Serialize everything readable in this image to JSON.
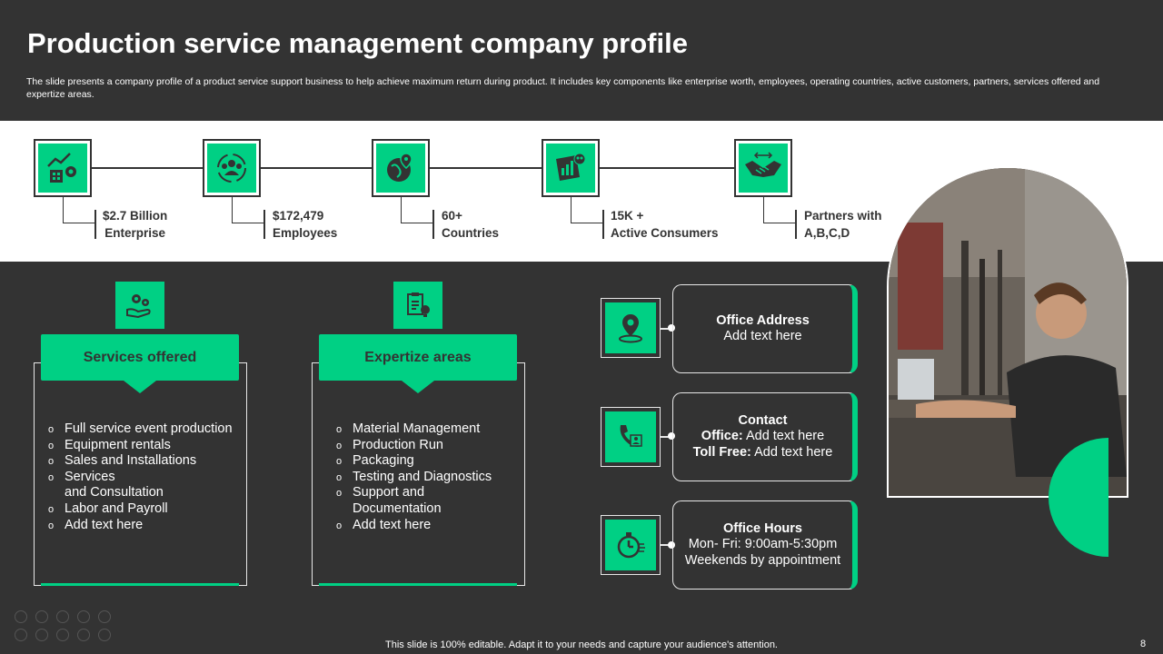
{
  "title": "Production service management company profile",
  "subtitle": "The slide presents a company profile of a product service support business to help achieve maximum return during product. It includes key components like enterprise worth, employees, operating countries, active customers, partners, services offered and expertize areas.",
  "stats": [
    {
      "icon": "growth-chart-icon",
      "line1": "$2.7 Billion",
      "line2": "Enterprise"
    },
    {
      "icon": "team-icon",
      "line1": "$172,479",
      "line2": "Employees"
    },
    {
      "icon": "globe-location-icon",
      "line1": "60+",
      "line2": "Countries"
    },
    {
      "icon": "customers-icon",
      "line1": "15K +",
      "line2": "Active Consumers"
    },
    {
      "icon": "handshake-icon",
      "line1": "Partners with",
      "line2": "A,B,C,D"
    }
  ],
  "services": {
    "icon": "hand-gears-icon",
    "heading": "Services offered",
    "items": [
      "Full service event production",
      "Equipment rentals",
      "Sales and Installations",
      "Services",
      "and Consultation",
      "Labor and Payroll",
      "Add text here"
    ]
  },
  "expertise": {
    "icon": "clipboard-bulb-icon",
    "heading": "Expertize areas",
    "items": [
      "Material Management",
      "Production Run",
      "Packaging",
      "Testing and Diagnostics",
      "Support and",
      "Documentation",
      "Add text here"
    ]
  },
  "contact": {
    "address": {
      "title": "Office Address",
      "text": "Add text here"
    },
    "phone": {
      "title": "Contact",
      "office_label": "Office:",
      "office_text": "Add text here",
      "tollfree_label": "Toll Free:",
      "tollfree_text": "Add text here"
    },
    "hours": {
      "title": "Office Hours",
      "line1": "Mon- Fri: 9:00am-5:30pm",
      "line2": "Weekends by appointment"
    }
  },
  "footer": "This slide is 100% editable. Adapt it to your needs and capture your audience's attention.",
  "page_number": "8",
  "colors": {
    "accent": "#00d084",
    "background": "#333333",
    "band": "#ffffff"
  }
}
